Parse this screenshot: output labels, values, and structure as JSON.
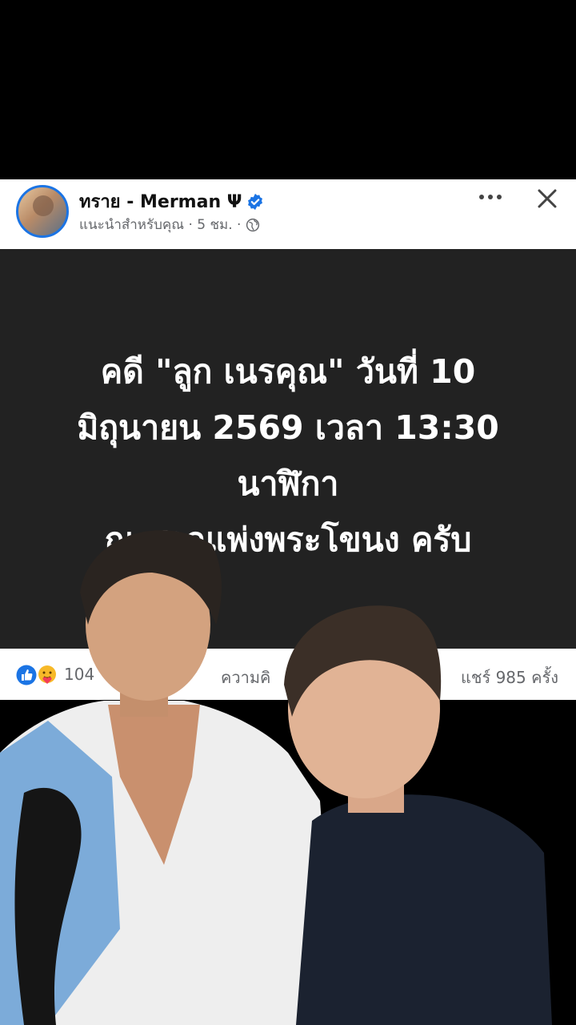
{
  "post": {
    "author": "ทราย - Merman Ψ",
    "meta_text": "แนะนำสำหรับคุณ · 5 ชม. ·",
    "icons": [
      "avatar",
      "verified-badge-icon",
      "globe-icon",
      "more-icon",
      "close-icon"
    ]
  },
  "image_text": {
    "line1": "คดี \"ลูก เนรคุณ\" วันที่ 10",
    "line2": "มิถุนายน 2569 เวลา 13:30",
    "line3": "นาฬิกา",
    "line4": "ณ ศาลแพ่งพระโขนง ครับ"
  },
  "reactions": {
    "count_text": "104",
    "comments_text": "ความคิ",
    "shares_text": "แชร์ 985 ครั้ง",
    "icons": [
      "like-icon",
      "care-icon"
    ]
  },
  "colors": {
    "accent": "#1b74e4",
    "image_bg": "#222222",
    "page_bg": "#000000"
  }
}
